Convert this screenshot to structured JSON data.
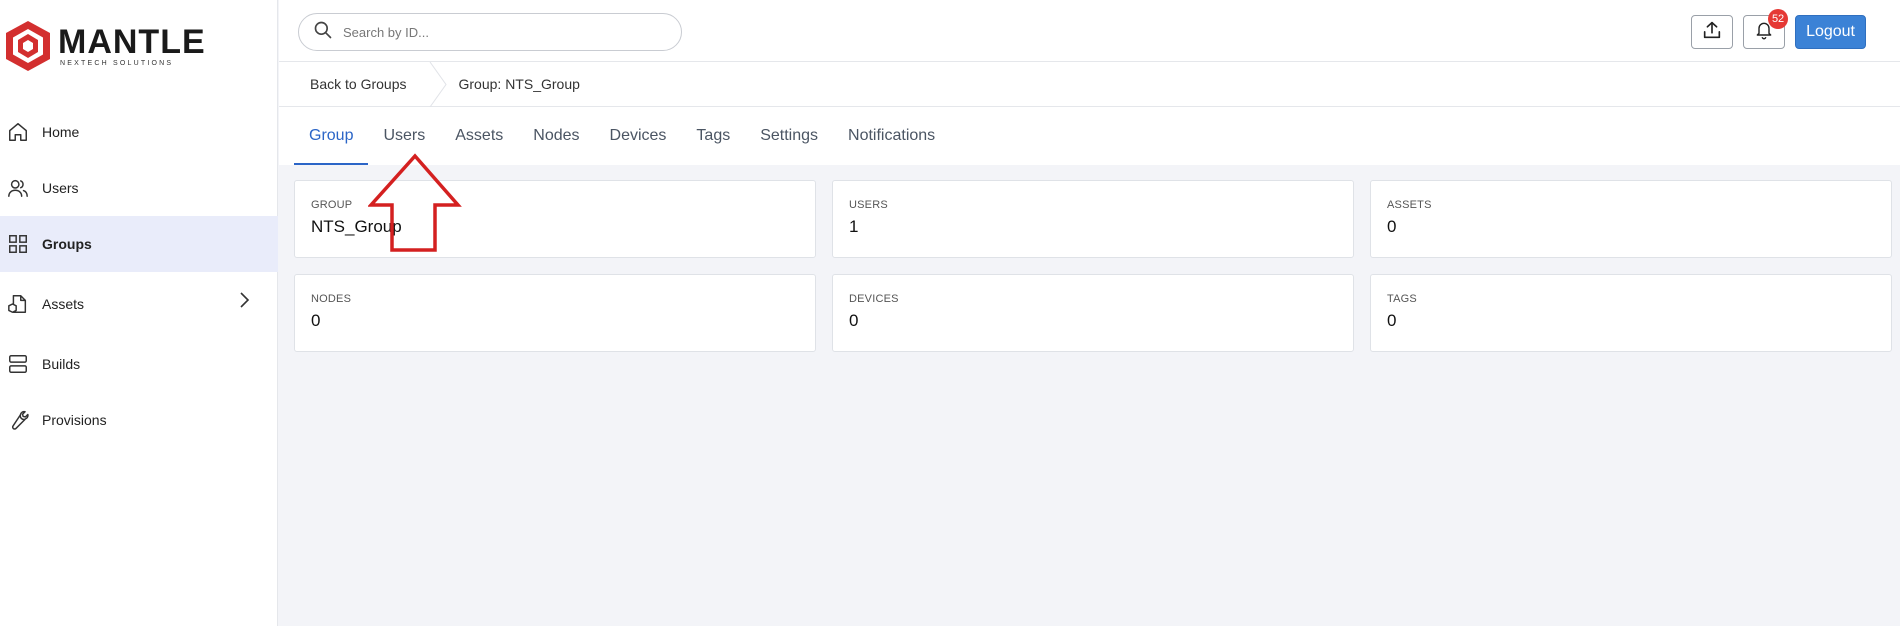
{
  "brand": {
    "name": "MANTLE",
    "tagline": "NEXTECH SOLUTIONS",
    "primary_color": "#d32f2f"
  },
  "sidebar": {
    "items": [
      {
        "label": "Home",
        "icon": "home-icon",
        "active": false
      },
      {
        "label": "Users",
        "icon": "users-icon",
        "active": false
      },
      {
        "label": "Groups",
        "icon": "grid-icon",
        "active": true
      },
      {
        "label": "Assets",
        "icon": "assets-icon",
        "active": false,
        "expandable": true
      },
      {
        "label": "Builds",
        "icon": "server-icon",
        "active": false
      },
      {
        "label": "Provisions",
        "icon": "wrench-icon",
        "active": false
      }
    ]
  },
  "topbar": {
    "search_placeholder": "Search by ID...",
    "notification_count": "52",
    "logout_label": "Logout"
  },
  "breadcrumb": {
    "back_label": "Back to Groups",
    "current_label": "Group: NTS_Group"
  },
  "tabs": [
    {
      "label": "Group",
      "active": true
    },
    {
      "label": "Users"
    },
    {
      "label": "Assets"
    },
    {
      "label": "Nodes"
    },
    {
      "label": "Devices"
    },
    {
      "label": "Tags"
    },
    {
      "label": "Settings"
    },
    {
      "label": "Notifications"
    }
  ],
  "cards": [
    {
      "label": "GROUP",
      "value": "NTS_Group"
    },
    {
      "label": "USERS",
      "value": "1"
    },
    {
      "label": "ASSETS",
      "value": "0"
    },
    {
      "label": "NODES",
      "value": "0"
    },
    {
      "label": "DEVICES",
      "value": "0"
    },
    {
      "label": "TAGS",
      "value": "0"
    }
  ],
  "colors": {
    "accent": "#2b65c7",
    "logout_bg": "#3b82d6",
    "badge": "#e53935",
    "annotation": "#d42020",
    "active_nav_bg": "#e9ecfa"
  }
}
